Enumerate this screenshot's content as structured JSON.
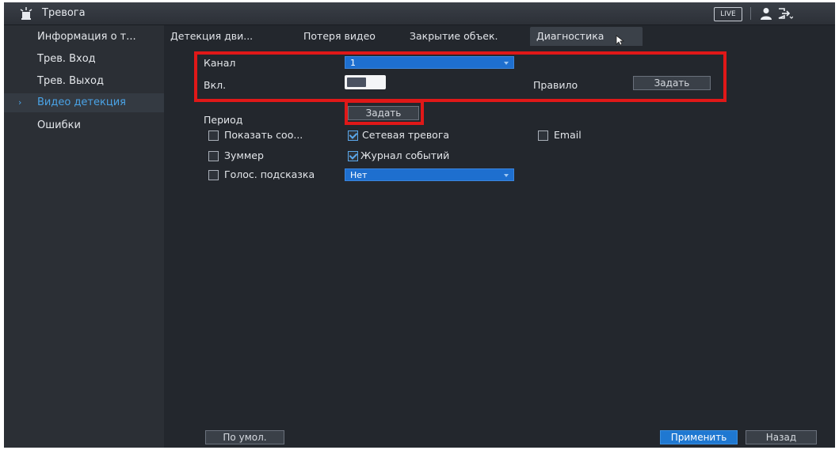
{
  "window": {
    "title": "Тревога",
    "live_label": "LIVE"
  },
  "sidebar": {
    "items": [
      {
        "label": "Информация о т..."
      },
      {
        "label": "Трев. Вход"
      },
      {
        "label": "Трев. Выход"
      },
      {
        "label": "Видео детекция",
        "active": true
      },
      {
        "label": "Ошибки"
      }
    ]
  },
  "tabs": [
    {
      "label": "Детекция дви..."
    },
    {
      "label": "Потеря видео"
    },
    {
      "label": "Закрытие объек."
    },
    {
      "label": "Диагностика",
      "active": true
    }
  ],
  "form": {
    "channel_label": "Канал",
    "channel_value": "1",
    "enable_label": "Вкл.",
    "rule_label": "Правило",
    "rule_button": "Задать",
    "period_label": "Период",
    "period_button": "Задать",
    "checks": {
      "show_message": {
        "label": "Показать соо...",
        "checked": false
      },
      "net_alarm": {
        "label": "Сетевая тревога",
        "checked": true
      },
      "email": {
        "label": "Email",
        "checked": false
      },
      "buzzer": {
        "label": "Зуммер",
        "checked": false
      },
      "event_log": {
        "label": "Журнал событий",
        "checked": true
      },
      "voice_prompt": {
        "label": "Голос. подсказка",
        "checked": false
      }
    },
    "voice_value": "Нет"
  },
  "footer": {
    "default_button": "По умол.",
    "apply_button": "Применить",
    "back_button": "Назад"
  },
  "colors": {
    "accent": "#1f78d1",
    "highlight": "#e01818",
    "background": "#23272d"
  }
}
